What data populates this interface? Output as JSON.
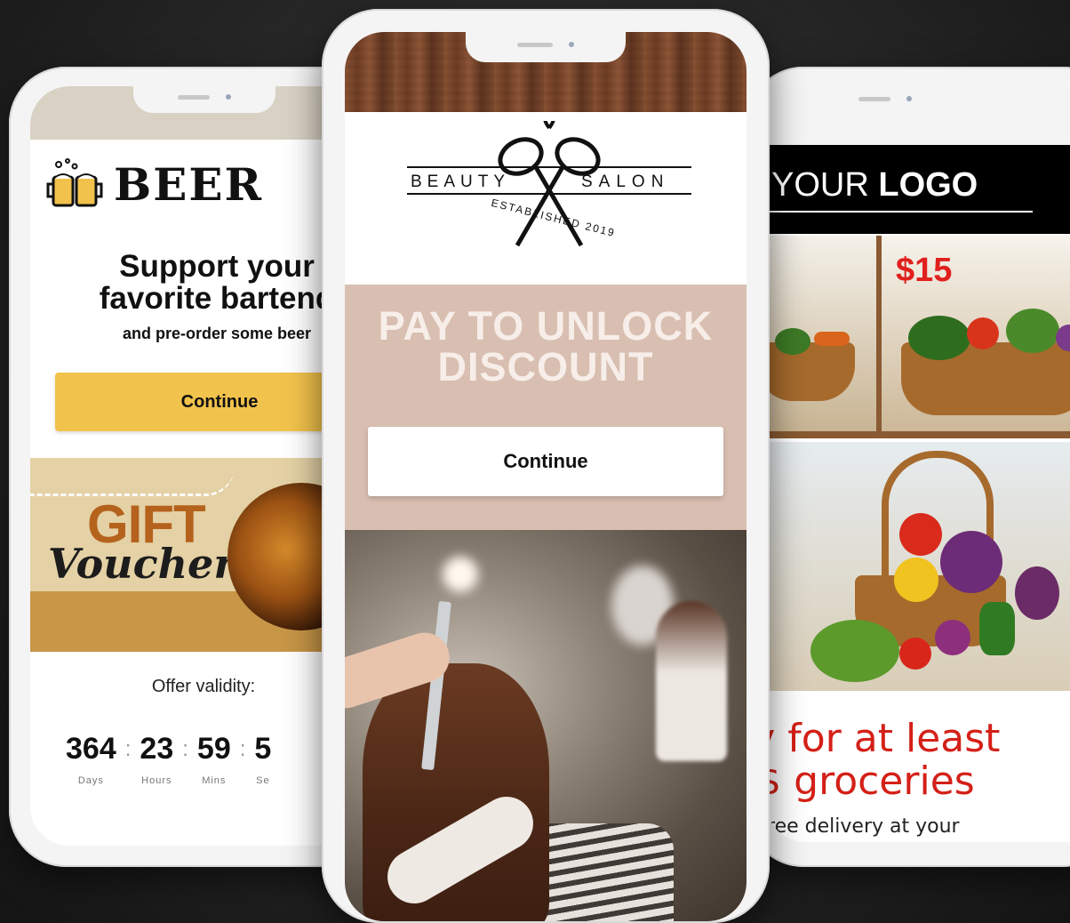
{
  "phones": {
    "left": {
      "brand": "BEER",
      "headline_line1": "Support your",
      "headline_line2": "favorite bartend",
      "subheadline": "and pre-order some beer",
      "continue_label": "Continue",
      "voucher": {
        "line1": "GIFT",
        "line2": "Voucher"
      },
      "offer_label": "Offer validity:",
      "countdown": [
        {
          "value": "364",
          "unit": "Days"
        },
        {
          "value": "23",
          "unit": "Hours"
        },
        {
          "value": "59",
          "unit": "Mins"
        },
        {
          "value": "5",
          "unit": "Se"
        }
      ]
    },
    "center": {
      "logo": {
        "word_left": "BEAUTY",
        "word_right": "SALON",
        "established": "ESTABLISHED 2019"
      },
      "headline_line1": "PAY TO UNLOCK",
      "headline_line2": "DISCOUNT",
      "continue_label": "Continue"
    },
    "right": {
      "logo_plain": "YOUR",
      "logo_bold": "LOGO",
      "price": "$15",
      "headline_line1": "ıy for at least",
      "headline_line2": ")$ groceries",
      "subline": "Free delivery at your"
    }
  },
  "colors": {
    "beer_button": "#f2c34c",
    "salon_band": "#d9bfb1",
    "grocery_red": "#d42018",
    "logo_bar": "#000000"
  },
  "icons": [
    "beer-mugs-icon",
    "scissors-icon"
  ]
}
